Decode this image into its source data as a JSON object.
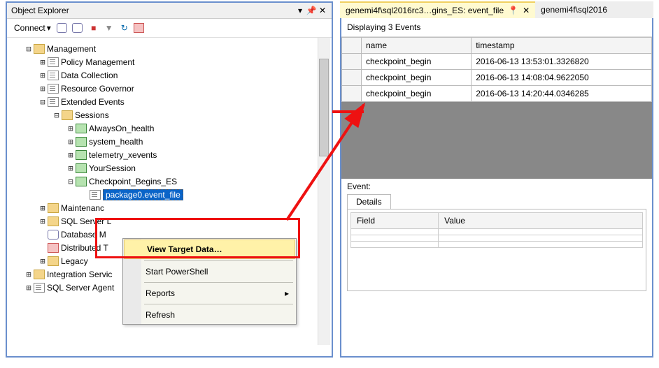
{
  "objectExplorer": {
    "title": "Object Explorer",
    "connect_label": "Connect",
    "tree": {
      "management": "Management",
      "policy": "Policy Management",
      "datacoll": "Data Collection",
      "resgov": "Resource Governor",
      "xevents": "Extended Events",
      "sessions": "Sessions",
      "alwayson": "AlwaysOn_health",
      "syshealth": "system_health",
      "telemetry": "telemetry_xevents",
      "yoursession": "YourSession",
      "checkpoint": "Checkpoint_Begins_ES",
      "package0": "package0.event_file",
      "maintenance": "Maintenanc",
      "sqlserver": "SQL Server L",
      "dbm": "Database M",
      "dist": "Distributed T",
      "legacy": "Legacy",
      "integration": "Integration Servic",
      "agent": "SQL Server Agent"
    }
  },
  "contextMenu": {
    "viewTarget": "View Target Data…",
    "powershell": "Start PowerShell",
    "reports": "Reports",
    "refresh": "Refresh"
  },
  "rightPanel": {
    "tab1": "genemi4f\\sql2016rc3…gins_ES: event_file",
    "tab2": "genemi4f\\sql2016",
    "displaying": "Displaying 3 Events",
    "col_name": "name",
    "col_ts": "timestamp",
    "rows": [
      {
        "name": "checkpoint_begin",
        "ts": "2016-06-13 13:53:01.3326820"
      },
      {
        "name": "checkpoint_begin",
        "ts": "2016-06-13 14:08:04.9622050"
      },
      {
        "name": "checkpoint_begin",
        "ts": "2016-06-13 14:20:44.0346285"
      }
    ],
    "event_label": "Event:",
    "details_tab": "Details",
    "field_col": "Field",
    "value_col": "Value"
  }
}
